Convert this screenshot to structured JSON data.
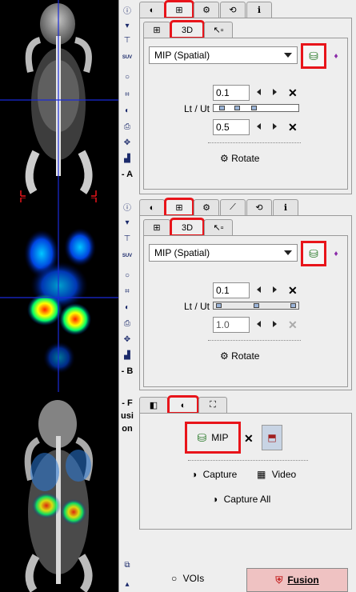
{
  "viewer": {
    "section_labels": {
      "a": "- A",
      "b": "- B",
      "fusion": "- Fusion"
    }
  },
  "tool_icons": [
    "info-icon",
    "dropdown-arrow-icon",
    "layout-icon",
    "suv-icon",
    "roi-circle-icon",
    "fit-icon",
    "contrast-icon",
    "print-icon",
    "crosshair-icon",
    "histogram-icon"
  ],
  "panel_a": {
    "main_tabs": [
      "contrast",
      "3d-view",
      "rotate",
      "dynamic",
      "info"
    ],
    "sub_tabs": {
      "first": "",
      "second": "3D",
      "third": ""
    },
    "mode_select": "MIP (Spatial)",
    "lower_value": "0.1",
    "upper_value": "0.5",
    "threshold_label": "Lt / Ut",
    "rotate_label": "Rotate"
  },
  "panel_b": {
    "main_tabs": [
      "contrast",
      "3d-view",
      "rotate",
      "curve",
      "dynamic",
      "info"
    ],
    "sub_tabs": {
      "second": "3D"
    },
    "mode_select": "MIP (Spatial)",
    "lower_value": "0.1",
    "upper_value": "1.0",
    "threshold_label": "Lt / Ut",
    "rotate_label": "Rotate"
  },
  "panel_fusion": {
    "mip_label": "MIP",
    "capture_label": "Capture",
    "video_label": "Video",
    "capture_all_label": "Capture All"
  },
  "bottom": {
    "vois_label": "VOIs",
    "fusion_label": "Fusion"
  },
  "colors": {
    "highlight": "#e8141a",
    "fusion_button": "#efc2c2",
    "crosshair": "#1a2bd8"
  }
}
